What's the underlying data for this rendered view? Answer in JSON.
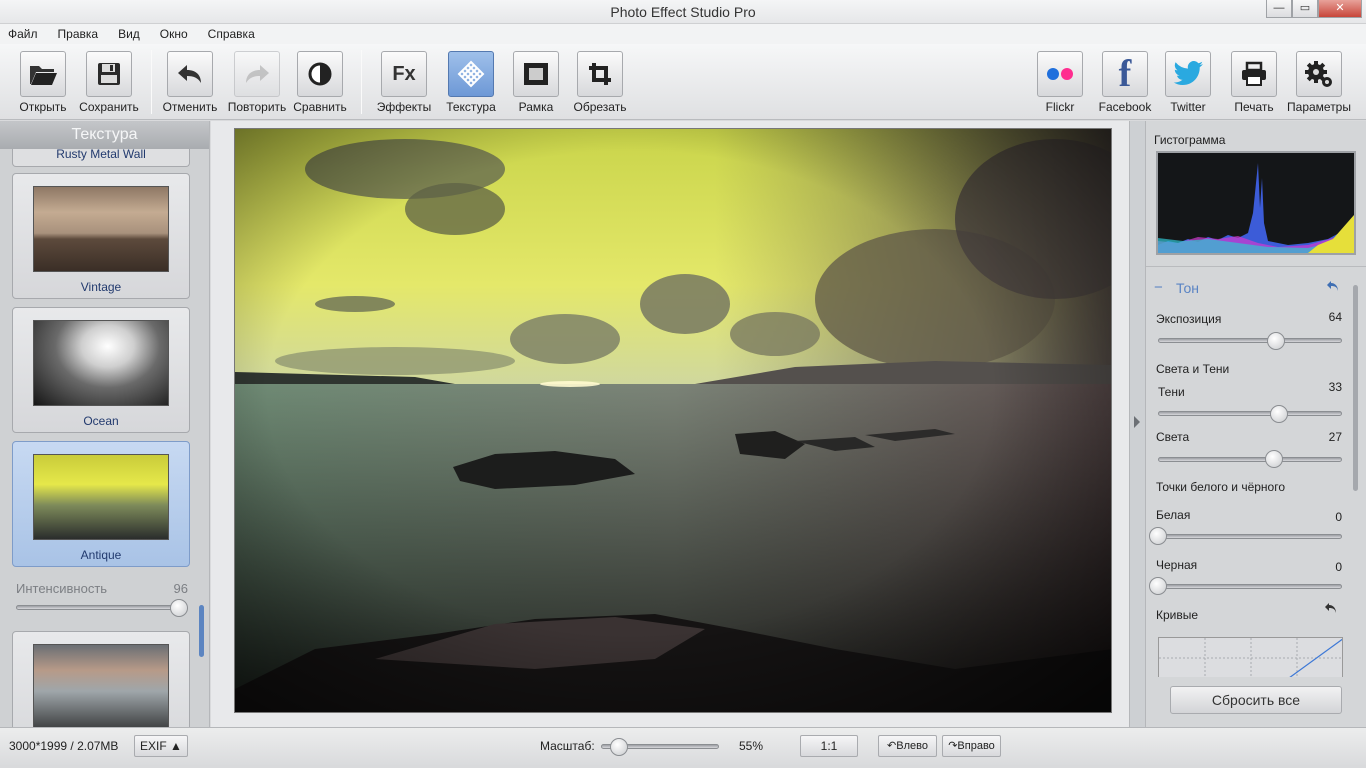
{
  "window": {
    "title": "Photo Effect Studio Pro",
    "controls": {
      "minimize": "—",
      "maximize": "▭",
      "close": "✕"
    }
  },
  "menu": [
    "Файл",
    "Правка",
    "Вид",
    "Окно",
    "Справка"
  ],
  "toolbar": {
    "open": "Открыть",
    "save": "Сохранить",
    "undo": "Отменить",
    "redo": "Повторить",
    "compare": "Сравнить",
    "effects": "Эффекты",
    "effects_glyph": "Fx",
    "texture": "Текстура",
    "frame": "Рамка",
    "crop": "Обрезать",
    "flickr": "Flickr",
    "facebook": "Facebook",
    "facebook_glyph": "f",
    "twitter": "Twitter",
    "print": "Печать",
    "settings": "Параметры",
    "active_tool": "texture"
  },
  "texture_panel": {
    "title": "Текстура",
    "partial_item": "Rusty Metal Wall",
    "items": [
      {
        "label": "Vintage",
        "selected": false
      },
      {
        "label": "Ocean",
        "selected": false
      },
      {
        "label": "Antique",
        "selected": true
      },
      {
        "label": "",
        "selected": false
      }
    ],
    "intensity": {
      "label": "Интенсивность",
      "value": "96",
      "fraction": 0.96
    }
  },
  "adjust_panel": {
    "histogram_title": "Гистограмма",
    "section_title": "Тон",
    "collapse_glyph": "−",
    "exposure": {
      "label": "Экспозиция",
      "value": "64",
      "fraction": 0.64
    },
    "shadows_highlights": "Света и Тени",
    "shadows": {
      "label": "Тени",
      "value": "33",
      "fraction": 0.66
    },
    "highlights": {
      "label": "Света",
      "value": "27",
      "fraction": 0.63
    },
    "white_black": "Точки белого и чёрного",
    "white": {
      "label": "Белая",
      "value": "0",
      "fraction": 0
    },
    "black": {
      "label": "Черная",
      "value": "0",
      "fraction": 0
    },
    "curves": "Кривые",
    "reset_all": "Сбросить все"
  },
  "status": {
    "image_info": "3000*1999 / 2.07MB",
    "exif": "EXIF ▲",
    "zoom_label": "Масштаб:",
    "zoom_value": "55%",
    "zoom_fraction": 0.08,
    "one_to_one": "1:1",
    "rotate_left": "Влево",
    "rotate_right": "Вправо"
  },
  "colors": {
    "accent": "#6d98d6",
    "selected_thumb": "#b8cde9",
    "facebook": "#3b5998",
    "twitter": "#2aa9e0",
    "flickr_blue": "#1f6fdc",
    "flickr_pink": "#ff2d8f"
  }
}
